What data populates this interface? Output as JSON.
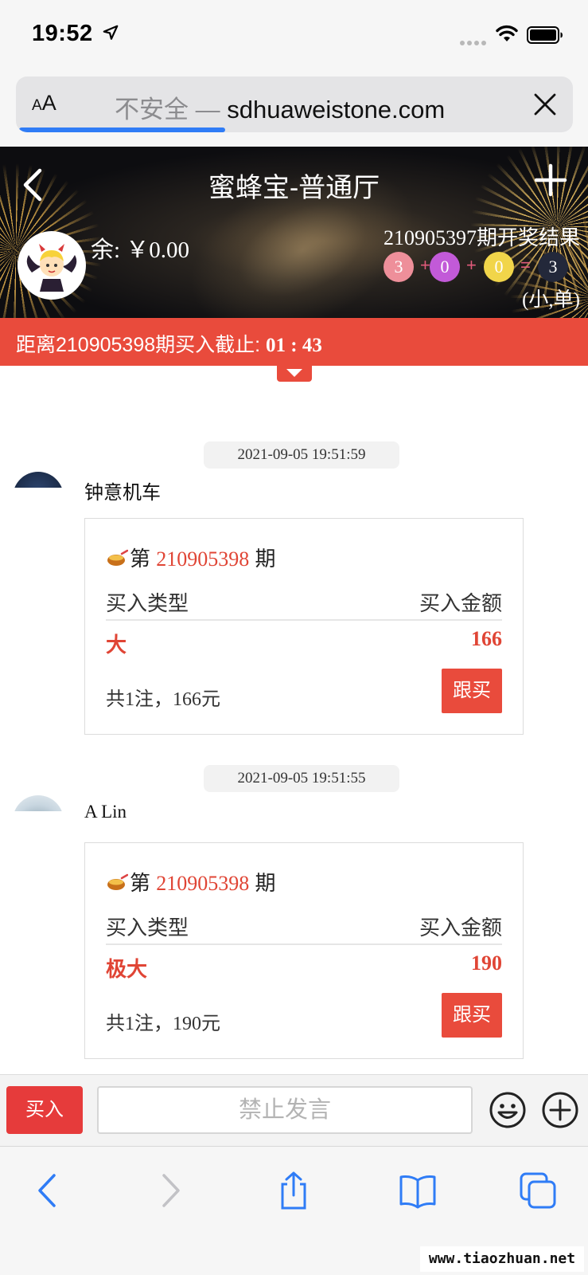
{
  "status_bar": {
    "time": "19:52"
  },
  "browser": {
    "aa_label_small": "A",
    "aa_label_large": "A",
    "security_label": "不安全 — ",
    "domain": "sdhuaweistone.com",
    "load_progress": 0.37
  },
  "header": {
    "title": "蜜蜂宝-普通厅",
    "balance": "余: ￥0.00",
    "result_title": "210905397期开奖结果",
    "balls": [
      {
        "value": "3",
        "color": "#ee8f9a"
      },
      {
        "value": "0",
        "color": "#c25ad8"
      },
      {
        "value": "0",
        "color": "#f1d54a"
      },
      {
        "value": "3",
        "color": "#23283a"
      }
    ],
    "operators": [
      "+",
      "+",
      "="
    ],
    "result_tag": "(小,单)"
  },
  "deadline": {
    "prefix": "距离210905398期买入截止: ",
    "countdown": "01 : 43"
  },
  "messages": [
    {
      "timestamp": "2021-09-05 19:51:59",
      "user": "钟意机车",
      "card": {
        "period_prefix": "第 ",
        "period": "210905398",
        "period_suffix": " 期",
        "col_type": "买入类型",
        "col_amount": "买入金额",
        "bet_type": "大",
        "bet_amount": "166",
        "summary": "共1注，166元",
        "follow_label": "跟买"
      }
    },
    {
      "timestamp": "2021-09-05 19:51:55",
      "user": "A Lin",
      "card": {
        "period_prefix": "第 ",
        "period": "210905398",
        "period_suffix": " 期",
        "col_type": "买入类型",
        "col_amount": "买入金额",
        "bet_type": "极大",
        "bet_amount": "190",
        "summary": "共1注，190元",
        "follow_label": "跟买"
      }
    }
  ],
  "input_bar": {
    "buy_label": "买入",
    "placeholder": "禁止发言"
  },
  "watermark": "www.tiaozhuan.net",
  "colors": {
    "accent_red": "#e94b3c",
    "safari_blue": "#2f7cf6"
  }
}
